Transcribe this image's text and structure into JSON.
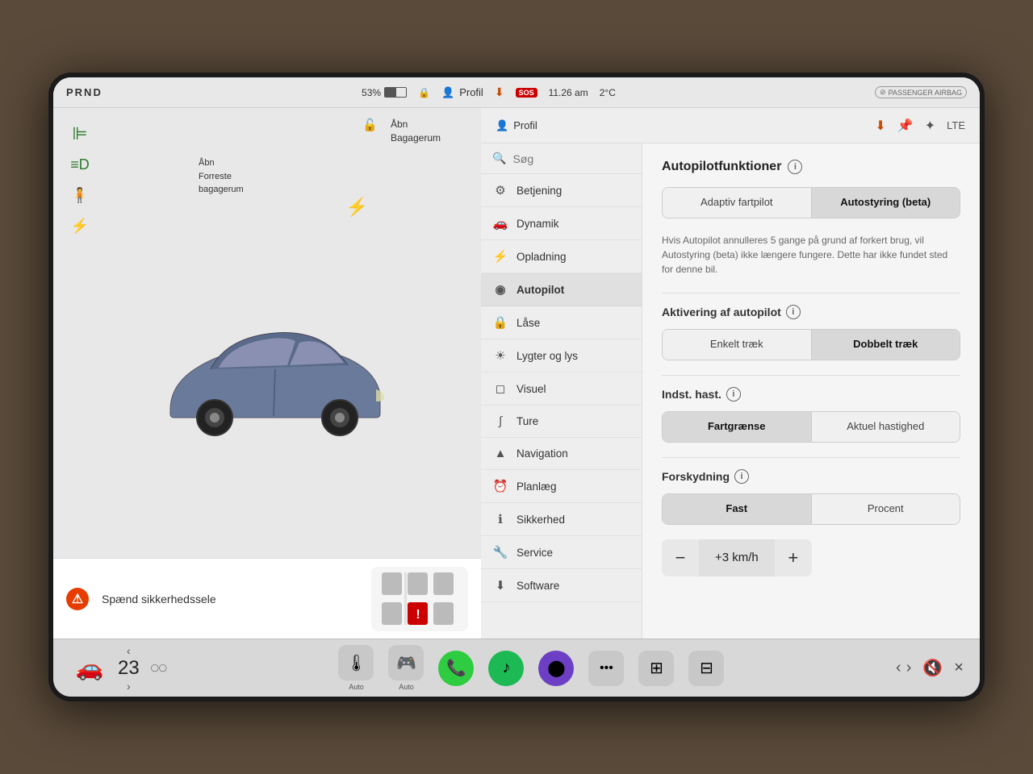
{
  "statusBar": {
    "prnd": "PRND",
    "batteryPercent": "53%",
    "time": "11.26 am",
    "temperature": "2°C",
    "profile": "Profil",
    "sos": "SOS",
    "passengerAirbag": "PASSENGER AIRBAG"
  },
  "leftPanel": {
    "trunkFront": "Åbn\nForreste\nbagagerum",
    "trunkRear": "Åbn\nBagagerum",
    "warning": "Spænd\nsikkerhedssele"
  },
  "rightHeader": {
    "profile": "Profil"
  },
  "search": {
    "placeholder": "Søg"
  },
  "navItems": [
    {
      "id": "betjening",
      "label": "Betjening",
      "icon": "⚙"
    },
    {
      "id": "dynamik",
      "label": "Dynamik",
      "icon": "🚗"
    },
    {
      "id": "opladning",
      "label": "Opladning",
      "icon": "⚡"
    },
    {
      "id": "autopilot",
      "label": "Autopilot",
      "icon": "◎",
      "active": true
    },
    {
      "id": "laase",
      "label": "Låse",
      "icon": "🔒"
    },
    {
      "id": "lygter",
      "label": "Lygter og lys",
      "icon": "☀"
    },
    {
      "id": "visuel",
      "label": "Visuel",
      "icon": "◻"
    },
    {
      "id": "ture",
      "label": "Ture",
      "icon": "∫"
    },
    {
      "id": "navigation",
      "label": "Navigation",
      "icon": "▲"
    },
    {
      "id": "planlaeg",
      "label": "Planlæg",
      "icon": "⏰"
    },
    {
      "id": "sikkerhed",
      "label": "Sikkerhed",
      "icon": "ℹ"
    },
    {
      "id": "service",
      "label": "Service",
      "icon": "🔧"
    },
    {
      "id": "software",
      "label": "Software",
      "icon": "⬇"
    }
  ],
  "autopilotDetail": {
    "sectionTitle": "Autopilotfunktioner",
    "btnAdaptiv": "Adaptiv\nfartpilot",
    "btnAutostyring": "Autostyring\n(beta)",
    "description": "Hvis Autopilot annulleres 5 gange på grund af forkert brug, vil Autostyring (beta) ikke længere fungere. Dette har ikke fundet sted for denne bil.",
    "aktivTitle": "Aktivering af autopilot",
    "btnEnkelt": "Enkelt træk",
    "btnDobbelt": "Dobbelt træk",
    "indstTitle": "Indst. hast.",
    "btnFartgraense": "Fartgrænse",
    "btnAktuel": "Aktuel hastighed",
    "forskydningTitle": "Forskydning",
    "btnFast": "Fast",
    "btnProcent": "Procent",
    "speedValue": "+3 km/h",
    "speedMinus": "−",
    "speedPlus": "+"
  },
  "taskbar": {
    "speedValue": "23",
    "speedUnit": "◯",
    "labelAuto1": "Auto",
    "labelAuto2": "Auto"
  }
}
